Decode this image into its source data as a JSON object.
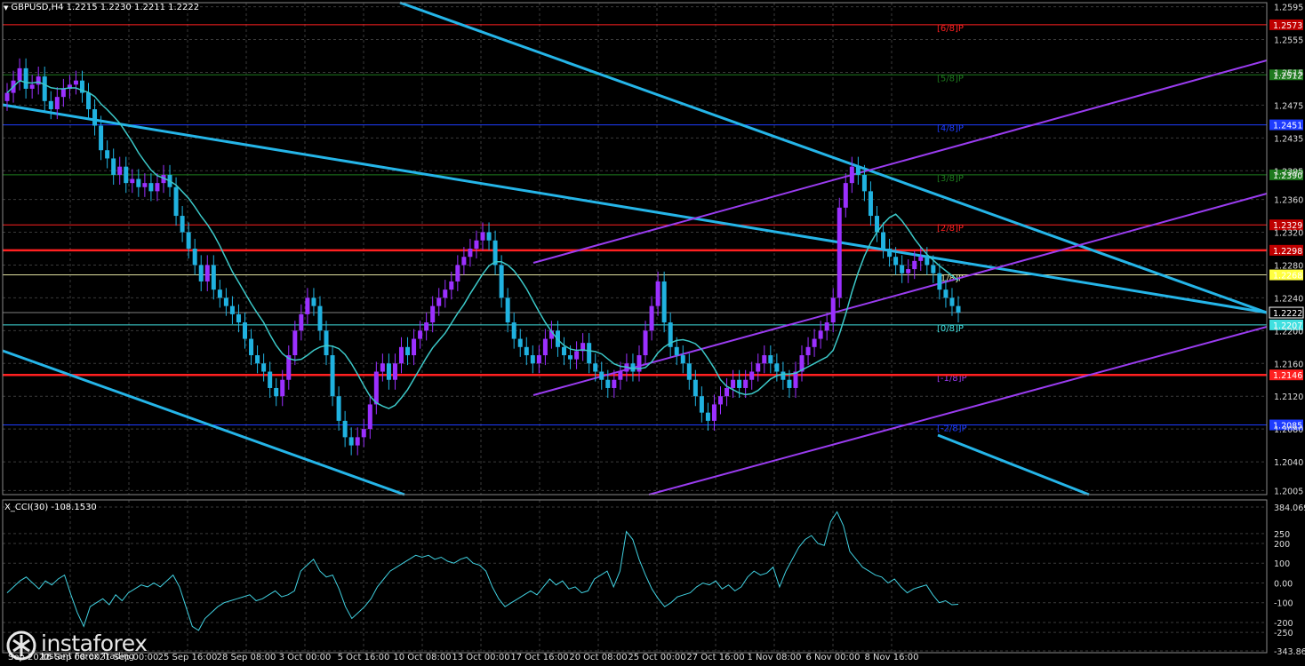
{
  "header": {
    "title": "GBPUSD,H4  1.2215 1.2230 1.2211 1.2222"
  },
  "indicator": {
    "title": "X_CCI(30) -108.1530"
  },
  "logo": {
    "brand": "instaforex",
    "tagline": "Instant Forex Trading",
    "icon": "instaforex-logo-icon"
  },
  "colors": {
    "background": "#000000",
    "grid": "#3a3a3a",
    "bull_candle": "#9b30ff",
    "bear_candle": "#20b2e0",
    "ma_line": "#3cc8c8",
    "channel_blue": "#25b5e8",
    "channel_purple": "#9a3cf0",
    "murray_red": "#ff2020",
    "cci_line": "#40d0e0"
  },
  "chart_data": {
    "type": "candlestick",
    "symbol": "GBPUSD",
    "timeframe": "H4",
    "ohlc_last": {
      "open": 1.2215,
      "high": 1.223,
      "low": 1.2211,
      "close": 1.2222
    },
    "y_axis": {
      "ylim": [
        1.2,
        1.26
      ],
      "ticks": [
        "1.2595",
        "1.2555",
        "1.2515",
        "1.2475",
        "1.2435",
        "1.2395",
        "1.2360",
        "1.2320",
        "1.2280",
        "1.2240",
        "1.2200",
        "1.2160",
        "1.2120",
        "1.2080",
        "1.2040",
        "1.2005"
      ]
    },
    "x_axis": {
      "ticks": [
        "Sep 2022",
        "16 Sep 08:00",
        "21 Sep 00:00",
        "25 Sep 16:00",
        "28 Sep 08:00",
        "3 Oct 00:00",
        "5 Oct 16:00",
        "10 Oct 08:00",
        "13 Oct 00:00",
        "17 Oct 16:00",
        "20 Oct 08:00",
        "25 Oct 00:00",
        "27 Oct 16:00",
        "1 Nov 08:00",
        "6 Nov 00:00",
        "8 Nov 16:00"
      ]
    },
    "murray_levels": [
      {
        "label": "[6/8]P",
        "price_label": "1.2573",
        "price": 1.2573,
        "color": "#ff2020",
        "box": "#c00000"
      },
      {
        "label": "[5/8]P",
        "price_label": "1.2512",
        "price": 1.2512,
        "color": "#1e7a1e",
        "box": "#1e7a1e"
      },
      {
        "label": "[4/8]P",
        "price_label": "1.2451",
        "price": 1.2451,
        "color": "#1e3cff",
        "box": "#1e3cff"
      },
      {
        "label": "[3/8]P",
        "price_label": "1.2390",
        "price": 1.239,
        "color": "#1e7a1e",
        "box": "#1e7a1e"
      },
      {
        "label": "[2/8]P",
        "price_label": "1.2329",
        "price": 1.2329,
        "color": "#ff2020",
        "box": "#c00000"
      },
      {
        "label": "[1/8]P",
        "price_label": "1.2268",
        "price": 1.2268,
        "color": "#e0e0a0",
        "box": "#ffff40"
      },
      {
        "label": "[0/8]P",
        "price_label": "1.2207",
        "price": 1.2207,
        "color": "#40e0e0",
        "box": "#40e0e0"
      },
      {
        "label": "[-1/8]P",
        "price_label": "1.2146",
        "price": 1.2146,
        "color": "#9a3cf0",
        "box": "#ff2020"
      },
      {
        "label": "[-2/8]P",
        "price_label": "1.2085",
        "price": 1.2085,
        "color": "#1e3cff",
        "box": "#1e3cff"
      }
    ],
    "horizontal_lines": [
      {
        "price": 1.2298,
        "price_label": "1.2298",
        "color": "#ff2020",
        "style": "thick"
      },
      {
        "price": 1.2146,
        "color": "#ff2020",
        "style": "thick"
      }
    ],
    "current_price_label": "1.2222",
    "current_price": 1.2222,
    "close_series": [
      1.249,
      1.2505,
      1.252,
      1.2495,
      1.25,
      1.251,
      1.248,
      1.247,
      1.2485,
      1.2495,
      1.25,
      1.2505,
      1.249,
      1.247,
      1.245,
      1.242,
      1.241,
      1.239,
      1.24,
      1.238,
      1.2385,
      1.2375,
      1.238,
      1.237,
      1.238,
      1.239,
      1.2375,
      1.234,
      1.232,
      1.23,
      1.228,
      1.226,
      1.228,
      1.225,
      1.224,
      1.223,
      1.222,
      1.221,
      1.219,
      1.217,
      1.216,
      1.215,
      1.213,
      1.212,
      1.214,
      1.217,
      1.22,
      1.222,
      1.224,
      1.223,
      1.22,
      1.217,
      1.212,
      1.209,
      1.207,
      1.206,
      1.207,
      1.208,
      1.211,
      1.215,
      1.216,
      1.214,
      1.216,
      1.218,
      1.217,
      1.219,
      1.22,
      1.221,
      1.223,
      1.224,
      1.225,
      1.226,
      1.228,
      1.229,
      1.23,
      1.231,
      1.232,
      1.231,
      1.228,
      1.224,
      1.221,
      1.219,
      1.218,
      1.217,
      1.216,
      1.217,
      1.219,
      1.22,
      1.218,
      1.217,
      1.2165,
      1.2175,
      1.2185,
      1.216,
      1.215,
      1.214,
      1.213,
      1.214,
      1.215,
      1.216,
      1.215,
      1.217,
      1.22,
      1.223,
      1.226,
      1.221,
      1.218,
      1.217,
      1.216,
      1.214,
      1.212,
      1.21,
      1.209,
      1.211,
      1.212,
      1.213,
      1.214,
      1.213,
      1.214,
      1.215,
      1.216,
      1.217,
      1.216,
      1.215,
      1.214,
      1.213,
      1.215,
      1.217,
      1.218,
      1.219,
      1.22,
      1.221,
      1.224,
      1.235,
      1.238,
      1.24,
      1.239,
      1.237,
      1.234,
      1.232,
      1.23,
      1.229,
      1.228,
      1.227,
      1.2275,
      1.2285,
      1.229,
      1.228,
      1.227,
      1.225,
      1.224,
      1.223,
      1.2222
    ],
    "cci": {
      "ylim": [
        -343.862,
        384.0699
      ],
      "ticks": [
        "384.0699",
        "250",
        "200",
        "100",
        "0.00",
        "-100",
        "-200",
        "-250",
        "-343.862"
      ],
      "values": [
        -50,
        -20,
        10,
        30,
        0,
        -30,
        10,
        -10,
        20,
        40,
        -60,
        -150,
        -220,
        -120,
        -100,
        -80,
        -110,
        -60,
        -90,
        -50,
        -30,
        -10,
        -20,
        0,
        -20,
        10,
        40,
        -20,
        -120,
        -220,
        -240,
        -180,
        -150,
        -120,
        -100,
        -90,
        -80,
        -70,
        -60,
        -90,
        -80,
        -60,
        -40,
        -70,
        -60,
        -40,
        60,
        90,
        120,
        60,
        30,
        40,
        -30,
        -120,
        -180,
        -150,
        -120,
        -80,
        -20,
        20,
        60,
        80,
        100,
        120,
        140,
        130,
        140,
        120,
        130,
        110,
        100,
        120,
        130,
        100,
        90,
        60,
        -20,
        -80,
        -120,
        -100,
        -80,
        -60,
        -40,
        -60,
        -20,
        20,
        -10,
        10,
        -30,
        -20,
        -50,
        -40,
        20,
        40,
        60,
        -20,
        60,
        260,
        220,
        120,
        40,
        -30,
        -80,
        -120,
        -100,
        -70,
        -60,
        -50,
        -20,
        0,
        -10,
        10,
        -30,
        -10,
        -40,
        -20,
        30,
        60,
        40,
        50,
        80,
        -20,
        60,
        120,
        180,
        220,
        240,
        200,
        190,
        310,
        360,
        290,
        160,
        120,
        80,
        60,
        40,
        30,
        0,
        20,
        -20,
        -50,
        -30,
        -20,
        -10,
        -60,
        -100,
        -90,
        -110,
        -108
      ]
    }
  }
}
